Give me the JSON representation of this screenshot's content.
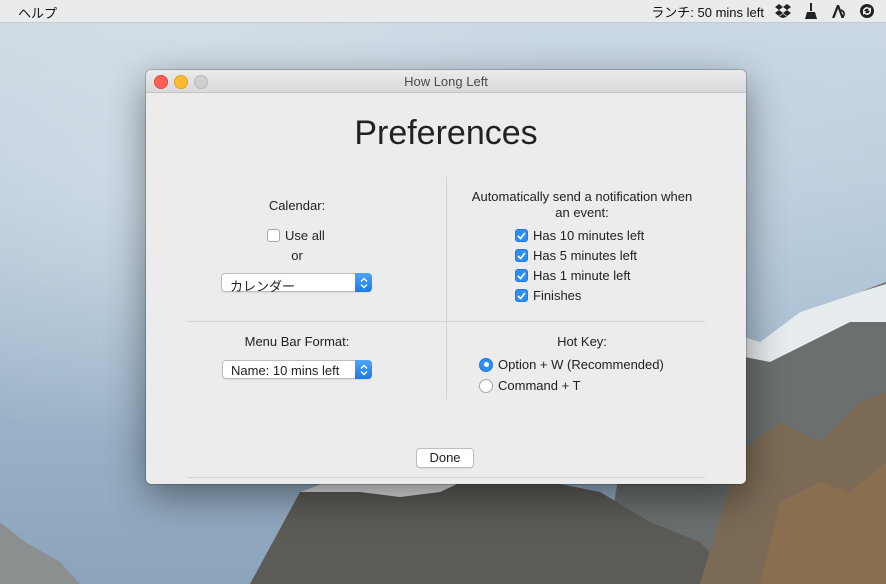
{
  "menubar": {
    "app_menu": "ヘルプ",
    "status_text": "ランチ: 50 mins left",
    "icons": [
      "dropbox-icon",
      "broom-icon",
      "a-app-icon",
      "sync-icon"
    ]
  },
  "window": {
    "title": "How Long Left",
    "heading": "Preferences"
  },
  "calendar": {
    "label": "Calendar:",
    "use_all_label": "Use all",
    "use_all_checked": false,
    "or_label": "or",
    "selected": "カレンダー"
  },
  "notifications": {
    "label_line1": "Automatically send a notification when",
    "label_line2": "an event:",
    "options": [
      {
        "label": "Has 10 minutes left",
        "checked": true
      },
      {
        "label": "Has 5 minutes left",
        "checked": true
      },
      {
        "label": "Has 1 minute left",
        "checked": true
      },
      {
        "label": "Finishes",
        "checked": true
      }
    ]
  },
  "menu_bar_format": {
    "label": "Menu Bar Format:",
    "selected": "Name: 10 mins left"
  },
  "hot_key": {
    "label": "Hot Key:",
    "options": [
      {
        "label": "Option + W (Recommended)",
        "selected": true
      },
      {
        "label": "Command + T",
        "selected": false
      }
    ]
  },
  "footer": {
    "done_label": "Done"
  },
  "colors": {
    "accent": "#2d8ef3",
    "close": "#fc5f57",
    "minimize": "#fdbc2e",
    "zoom_disabled": "#d0d0d0"
  }
}
